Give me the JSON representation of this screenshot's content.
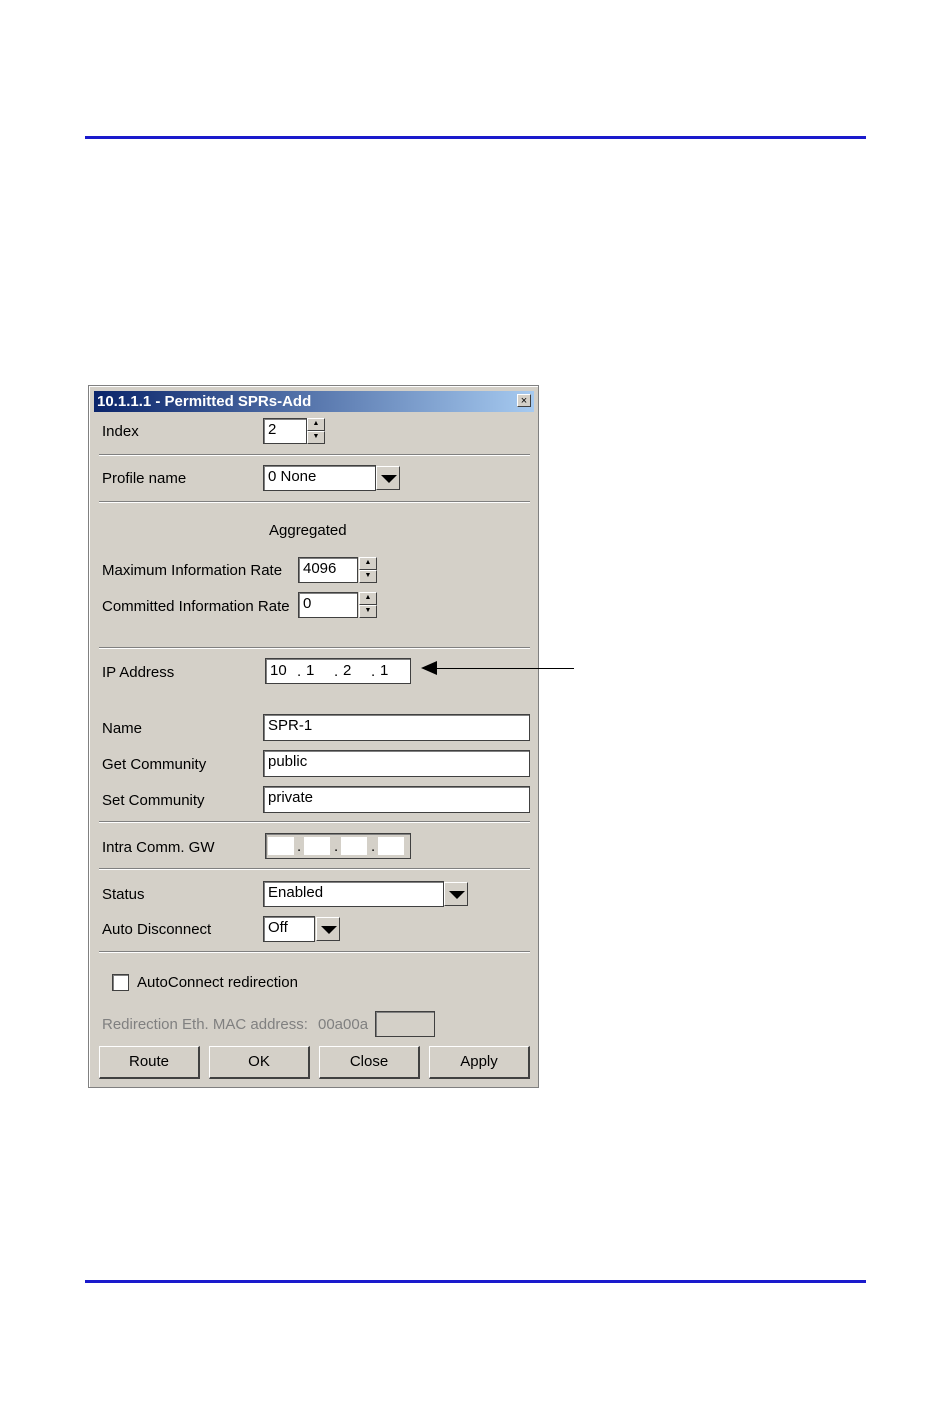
{
  "dialog": {
    "title": "10.1.1.1 - Permitted SPRs-Add",
    "close_glyph": "×",
    "index_label": "Index",
    "index_value": "2",
    "profile_label": "Profile name",
    "profile_value": "0 None",
    "aggregated_heading": "Aggregated",
    "mir_label": "Maximum Information Rate",
    "mir_value": "4096",
    "cir_label": "Committed Information Rate",
    "cir_value": "0",
    "ip_label": "IP Address",
    "ip_octets": [
      "10",
      "1",
      "2",
      "1"
    ],
    "ip_dot": ".",
    "name_label": "Name",
    "name_value": "SPR-1",
    "get_comm_label": "Get Community",
    "get_comm_value": "public",
    "set_comm_label": "Set Community",
    "set_comm_value": "private",
    "intra_gw_label": "Intra Comm. GW",
    "intra_gw_octets": [
      "",
      "",
      "",
      ""
    ],
    "status_label": "Status",
    "status_value": "Enabled",
    "auto_disc_label": "Auto Disconnect",
    "auto_disc_value": "Off",
    "autoconnect_label": "AutoConnect redirection",
    "autoconnect_checked": false,
    "mac_label": "Redirection Eth. MAC address:",
    "mac_prefix": "00a00a",
    "mac_value": "",
    "buttons": {
      "route": "Route",
      "ok": "OK",
      "close": "Close",
      "apply": "Apply"
    }
  },
  "colors": {
    "rule": "#1a1acc",
    "dialog_bg": "#d4d0c8",
    "title_start": "#0a246a",
    "title_end": "#a6caf0"
  }
}
